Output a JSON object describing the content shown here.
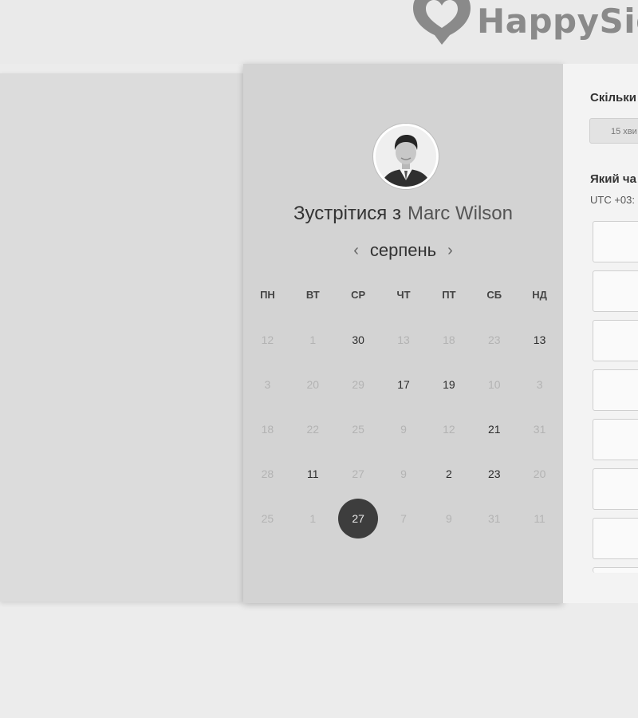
{
  "header": {
    "brand_name": "HappySig",
    "logo_icon": "heart-speech-bubble-icon",
    "logo_color": "#8a8a8a"
  },
  "calendar": {
    "title_prefix": "Зустрітися з",
    "host_name": "Marc Wilson",
    "month": "серпень",
    "prev_icon": "chevron-left-icon",
    "next_icon": "chevron-right-icon",
    "weekdays": [
      "ПН",
      "ВТ",
      "СР",
      "ЧТ",
      "ПТ",
      "СБ",
      "НД"
    ],
    "weeks": [
      [
        {
          "d": "12",
          "s": "dis"
        },
        {
          "d": "1",
          "s": "dis"
        },
        {
          "d": "30",
          "s": "av"
        },
        {
          "d": "13",
          "s": "dis"
        },
        {
          "d": "18",
          "s": "dis"
        },
        {
          "d": "23",
          "s": "dis"
        },
        {
          "d": "13",
          "s": "av"
        }
      ],
      [
        {
          "d": "3",
          "s": "dis"
        },
        {
          "d": "20",
          "s": "dis"
        },
        {
          "d": "29",
          "s": "dis"
        },
        {
          "d": "17",
          "s": "av"
        },
        {
          "d": "19",
          "s": "av"
        },
        {
          "d": "10",
          "s": "dis"
        },
        {
          "d": "3",
          "s": "dis"
        }
      ],
      [
        {
          "d": "18",
          "s": "dis"
        },
        {
          "d": "22",
          "s": "dis"
        },
        {
          "d": "25",
          "s": "dis"
        },
        {
          "d": "9",
          "s": "dis"
        },
        {
          "d": "12",
          "s": "dis"
        },
        {
          "d": "21",
          "s": "av"
        },
        {
          "d": "31",
          "s": "dis"
        }
      ],
      [
        {
          "d": "28",
          "s": "dis"
        },
        {
          "d": "11",
          "s": "av"
        },
        {
          "d": "27",
          "s": "dis"
        },
        {
          "d": "9",
          "s": "dis"
        },
        {
          "d": "2",
          "s": "av"
        },
        {
          "d": "23",
          "s": "av"
        },
        {
          "d": "20",
          "s": "dis"
        }
      ],
      [
        {
          "d": "25",
          "s": "dis"
        },
        {
          "d": "1",
          "s": "dis"
        },
        {
          "d": "27",
          "s": "sel"
        },
        {
          "d": "7",
          "s": "dis"
        },
        {
          "d": "9",
          "s": "dis"
        },
        {
          "d": "31",
          "s": "dis"
        },
        {
          "d": "11",
          "s": "dis"
        }
      ]
    ],
    "selected_color": "#3d3d3d"
  },
  "booking": {
    "duration_question": "Скільки",
    "duration_value": "15 хви",
    "time_question": "Який ча",
    "timezone": "UTC +03:",
    "slot_count_visible": 7
  }
}
